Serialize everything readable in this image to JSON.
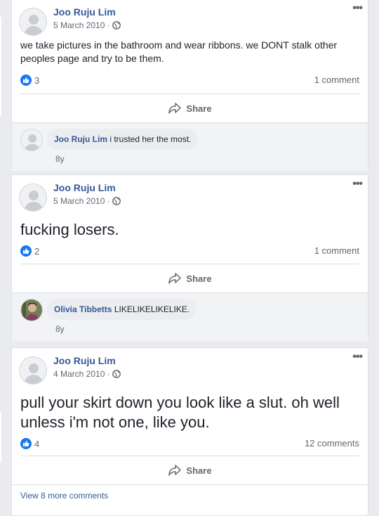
{
  "posts": [
    {
      "author": "Joo Ruju Lim",
      "date": "5 March 2010 ·",
      "text": "we take pictures in the bathroom and wear ribbons. we DONT stalk other peoples page and try to be them.",
      "likes": "3",
      "comments_count": "1 comment",
      "share_label": "Share",
      "comment": {
        "author": "Joo Ruju Lim",
        "text": "i trusted her the most.",
        "time": "8y"
      }
    },
    {
      "author": "Joo Ruju Lim",
      "date": "5 March 2010 ·",
      "text": "fucking losers.",
      "likes": "2",
      "comments_count": "1 comment",
      "share_label": "Share",
      "comment": {
        "author": "Olivia Tibbetts",
        "text": "LIKELIKELIKELIKE.",
        "time": "8y"
      }
    },
    {
      "author": "Joo Ruju Lim",
      "date": "4 March 2010 ·",
      "text": "pull your skirt down you look like a slut. oh well unless i'm not one, like you.",
      "likes": "4",
      "comments_count": "12 comments",
      "share_label": "Share",
      "view_more": "View 8 more comments"
    }
  ],
  "more_icon": "•••",
  "icons": {
    "globe": "globe-icon",
    "like": "like-thumb-icon",
    "share": "share-arrow-icon",
    "more": "more-options-icon"
  },
  "colors": {
    "link": "#385898",
    "like": "#1877f2",
    "background": "#e9ebee"
  }
}
